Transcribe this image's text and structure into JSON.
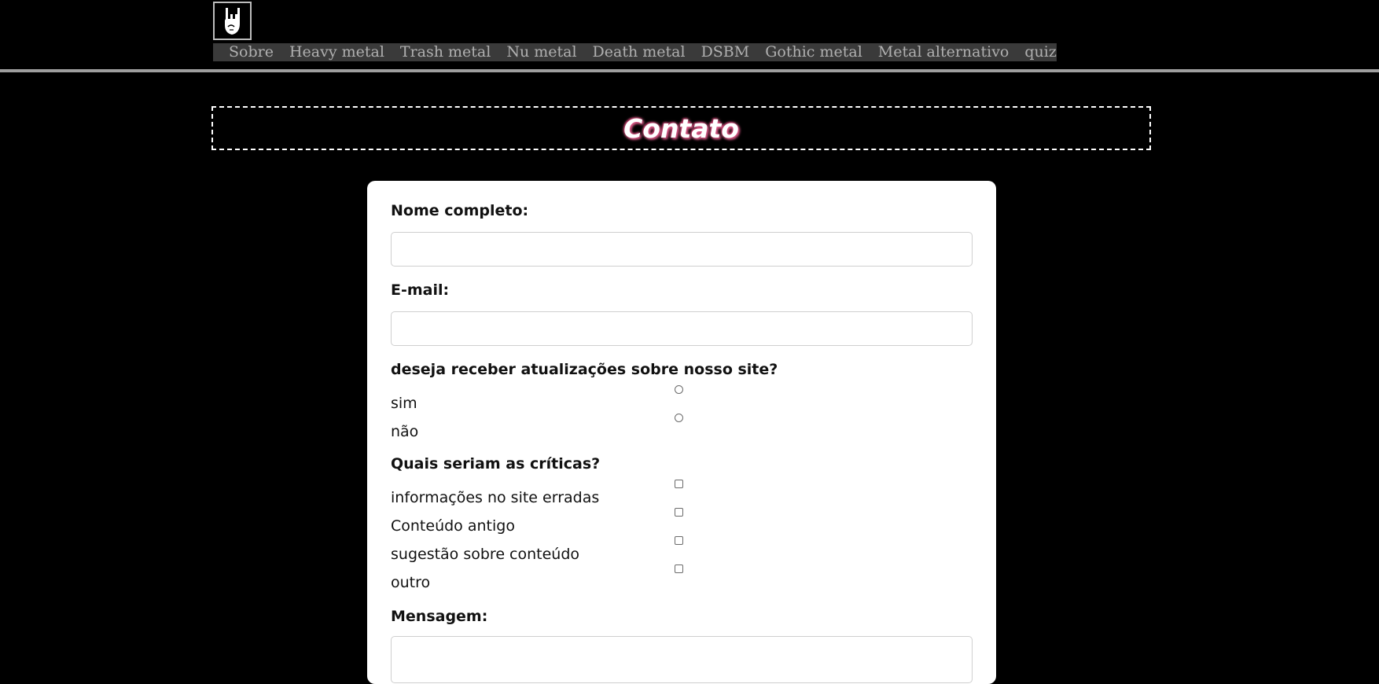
{
  "header": {
    "logo_icon": "rock-hand-icon",
    "nav_items": [
      {
        "label": "Sobre"
      },
      {
        "label": "Heavy metal"
      },
      {
        "label": "Trash metal"
      },
      {
        "label": "Nu metal"
      },
      {
        "label": "Death metal"
      },
      {
        "label": "DSBM"
      },
      {
        "label": "Gothic metal"
      },
      {
        "label": "Metal alternativo"
      },
      {
        "label": "quiz"
      }
    ]
  },
  "page": {
    "title": "Contato"
  },
  "form": {
    "name_label": "Nome completo:",
    "name_value": "",
    "email_label": "E-mail:",
    "email_value": "",
    "updates_question": "deseja receber atualizações sobre nosso site?",
    "updates_options": [
      {
        "label": "sim",
        "checked": false
      },
      {
        "label": "não",
        "checked": false
      }
    ],
    "critiques_question": "Quais seriam as críticas?",
    "critiques_options": [
      {
        "label": "informações no site erradas",
        "checked": false
      },
      {
        "label": "Conteúdo antigo",
        "checked": false
      },
      {
        "label": "sugestão sobre conteúdo",
        "checked": false
      },
      {
        "label": "outro",
        "checked": false
      }
    ],
    "message_label": "Mensagem:",
    "message_value": ""
  }
}
